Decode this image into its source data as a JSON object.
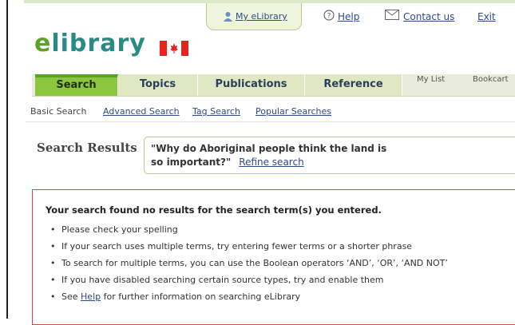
{
  "header": {
    "my_elibrary": "My eLibrary",
    "help": "Help",
    "contact_us": "Contact us",
    "exit": "Exit",
    "logo_e": "e",
    "logo_rest": "library"
  },
  "nav": {
    "tabs": [
      {
        "label": "Search",
        "active": true
      },
      {
        "label": "Topics",
        "active": false
      },
      {
        "label": "Publications",
        "active": false
      },
      {
        "label": "Reference",
        "active": false
      }
    ],
    "my_list": "My List",
    "bookcart": "Bookcart"
  },
  "subnav": {
    "current": "Basic Search",
    "links": [
      "Advanced Search",
      "Tag Search",
      "Popular Searches"
    ]
  },
  "results": {
    "heading": "Search Results",
    "query_line1": "\"Why do Aboriginal people think the land is",
    "query_line2": "so important?\"",
    "refine": "Refine search"
  },
  "message": {
    "title": "Your search found no results for the search term(s) you entered.",
    "items": [
      "Please check your spelling",
      "If your search uses multiple terms, try entering fewer terms or a shorter phrase",
      "To search for multiple terms, you can use the Boolean operators ‘AND’, ‘OR’, ‘AND NOT’",
      "If you have disabled searching certain source types, try and enable them"
    ],
    "last_pre": "See",
    "last_link": "Help",
    "last_post": "for further information on searching eLibrary"
  },
  "colors": {
    "brand_green": "#8cc63f",
    "logo_teal": "#2a8a84",
    "link_blue": "#2e4a8c",
    "alert_red": "#c84a4a"
  }
}
